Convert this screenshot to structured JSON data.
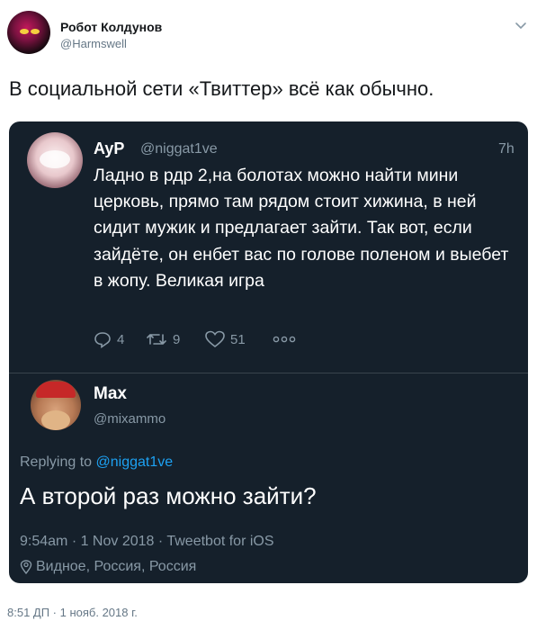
{
  "author": {
    "display_name": "Робот Колдунов",
    "handle": "@Harmswell"
  },
  "tweet_text": "В социальной сети «Твиттер» всё как обычно.",
  "quoted": {
    "name": "AyP",
    "handle": "@niggat1ve",
    "time": "7h",
    "body": "Ладно в рдр 2,на болотах можно найти мини церковь, прямо там рядом стоит хижина, в ней сидит мужик и предлагает зайти. Так вот, если зайдёте, он енбет вас по голове поленом и выебет в жопу. Великая игра",
    "stats": {
      "replies": "4",
      "retweets": "9",
      "likes": "51"
    }
  },
  "reply": {
    "name": "Max",
    "handle": "@mixammo",
    "replying_prefix": "Replying to",
    "replying_to": "@niggat1ve",
    "text": "А второй раз можно зайти?",
    "meta": "9:54am · 1 Nov 2018 · Tweetbot for iOS",
    "location": "Видное, Россия, Россия"
  },
  "footer_timestamp": "8:51 ДП · 1 нояб. 2018 г.",
  "colors": {
    "card_bg": "#15202b",
    "link_blue": "#1da1f2",
    "muted": "#8899a6"
  }
}
